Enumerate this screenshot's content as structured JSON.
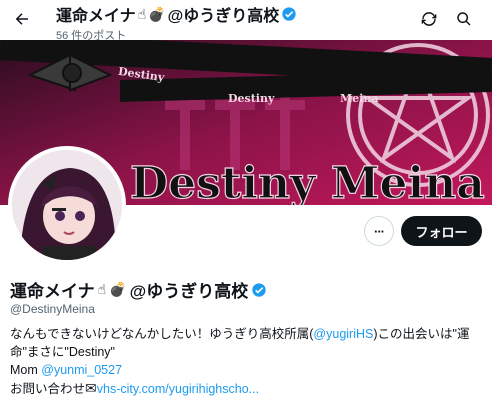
{
  "header": {
    "name_text": "運命メイナ",
    "name_suffix": "@ゆうぎり高校",
    "post_count": "56 件のポスト"
  },
  "banner": {
    "brand_text": "Destiny",
    "brand_text2": "Meina",
    "big_text": "Destiny Meina"
  },
  "profile": {
    "display_name": "運命メイナ",
    "display_suffix": "@ゆうぎり高校",
    "handle": "@DestinyMeina",
    "more_label": "···",
    "follow_label": "フォロー"
  },
  "bio": {
    "line1_a": "なんもできないけどなんかしたい！ゆうぎり高校所属(",
    "line1_link": "@yugiriHS",
    "line1_b": ")この出会いは\"運",
    "line2": "命\"まさに\"Destiny\"",
    "line3_a": "Mom ",
    "line3_link": "@yunmi_0527",
    "line4_a": "お問い合わせ",
    "line4_link": "vhs-city.com/yugirihighscho..."
  },
  "colors": {
    "accent": "#1d9bf0",
    "banner_pink": "#c2185b",
    "follow_bg": "#0f1419"
  },
  "icons": [
    "back-arrow-icon",
    "sync-icon",
    "search-icon",
    "verified-badge-icon",
    "hand-emoji-icon",
    "bomb-emoji-icon",
    "mail-emoji-icon"
  ]
}
